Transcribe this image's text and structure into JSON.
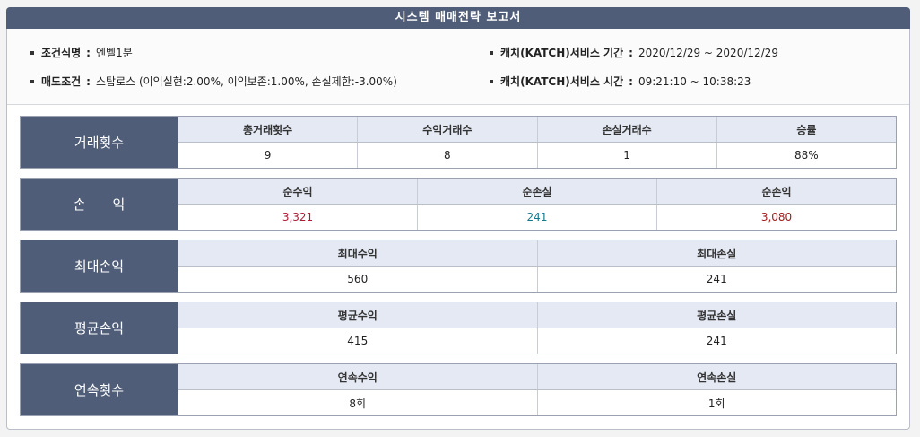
{
  "title": "시스템 매매전략 보고서",
  "info": {
    "formula_label": "조건식명",
    "formula_value": "엔벨1분",
    "sell_label": "매도조건",
    "sell_value": "스탑로스 (이익실현:2.00%, 이익보존:1.00%, 손실제한:-3.00%)",
    "period_label": "캐치(KATCH)서비스 기간",
    "period_value": "2020/12/29 ~ 2020/12/29",
    "time_label": "캐치(KATCH)서비스 시간",
    "time_value": "09:21:10 ~ 10:38:23",
    "separator": ":"
  },
  "sections": {
    "trades": {
      "title": "거래횟수",
      "headers": [
        "총거래횟수",
        "수익거래수",
        "손실거래수",
        "승률"
      ],
      "values": [
        "9",
        "8",
        "1",
        "88%"
      ]
    },
    "pnl": {
      "title": "손　　익",
      "headers": [
        "순수익",
        "순손실",
        "순손익"
      ],
      "values": [
        "3,321",
        "241",
        "3,080"
      ]
    },
    "max": {
      "title": "최대손익",
      "headers": [
        "최대수익",
        "최대손실"
      ],
      "values": [
        "560",
        "241"
      ]
    },
    "avg": {
      "title": "평균손익",
      "headers": [
        "평균수익",
        "평균손실"
      ],
      "values": [
        "415",
        "241"
      ]
    },
    "streak": {
      "title": "연속횟수",
      "headers": [
        "연속수익",
        "연속손실"
      ],
      "values": [
        "8회",
        "1회"
      ]
    }
  },
  "colors": {
    "header_bg": "#4f5d78",
    "profit": "#b01a34",
    "loss": "#157a8c",
    "net": "#a31a1a"
  }
}
